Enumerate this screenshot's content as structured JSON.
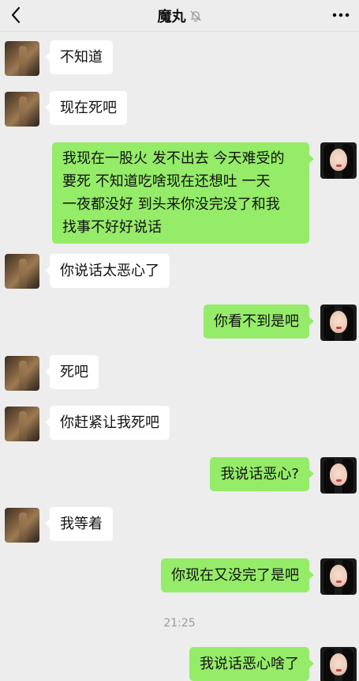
{
  "header": {
    "title": "魔丸",
    "back_icon": "chevron-left-icon",
    "mute_icon": "bell-muted-icon",
    "more_icon": "more-dots-icon"
  },
  "colors": {
    "background": "#ededed",
    "incoming_bubble": "#ffffff",
    "outgoing_bubble": "#95ec69",
    "timestamp": "#9a9a9a"
  },
  "messages": [
    {
      "side": "left",
      "text": "不知道"
    },
    {
      "side": "left",
      "text": "现在死吧"
    },
    {
      "side": "right",
      "lines": [
        "我现在一股火 发不出去 今天难受的",
        "要死  不知道吃啥现在还想吐  一天",
        "一夜都没好 到头来你没完没了和我",
        "找事不好好说话"
      ]
    },
    {
      "side": "left",
      "text": "你说话太恶心了"
    },
    {
      "side": "right",
      "text": "你看不到是吧"
    },
    {
      "side": "left",
      "text": "死吧"
    },
    {
      "side": "left",
      "text": "你赶紧让我死吧"
    },
    {
      "side": "right",
      "text": "我说话恶心?"
    },
    {
      "side": "left",
      "text": "我等着"
    },
    {
      "side": "right",
      "text": "你现在又没完了是吧"
    },
    {
      "side": "right",
      "text": "我说话恶心啥了"
    }
  ],
  "timestamp": "21:25"
}
